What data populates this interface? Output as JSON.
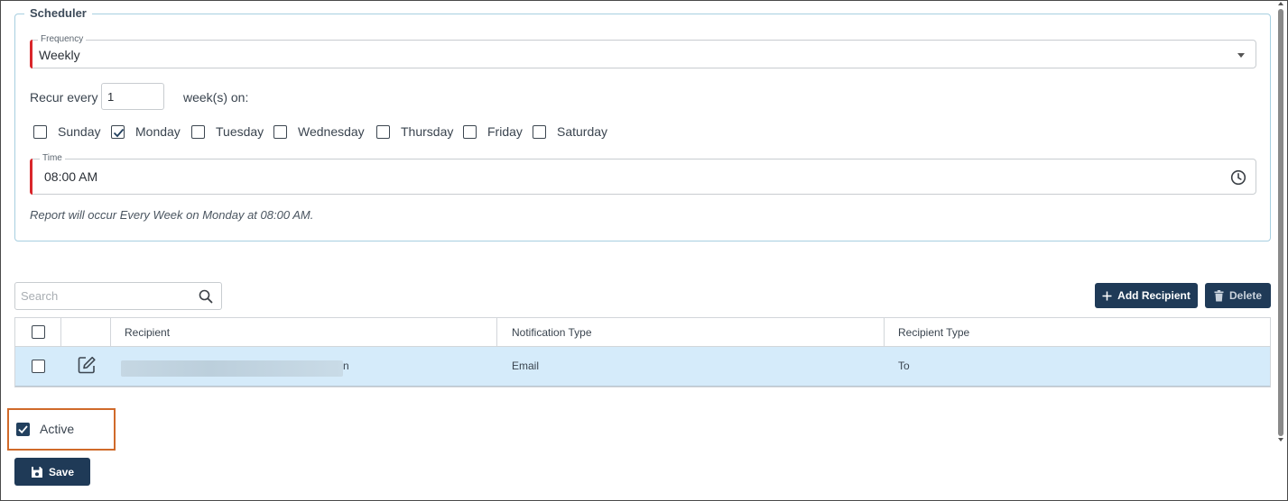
{
  "scheduler": {
    "title": "Scheduler",
    "frequency": {
      "label": "Frequency",
      "value": "Weekly"
    },
    "recur": {
      "prefix": "Recur every",
      "value": "1",
      "suffix": "week(s) on:"
    },
    "days": [
      {
        "label": "Sunday",
        "checked": false
      },
      {
        "label": "Monday",
        "checked": true
      },
      {
        "label": "Tuesday",
        "checked": false
      },
      {
        "label": "Wednesday",
        "checked": false
      },
      {
        "label": "Thursday",
        "checked": false
      },
      {
        "label": "Friday",
        "checked": false
      },
      {
        "label": "Saturday",
        "checked": false
      }
    ],
    "time": {
      "label": "Time",
      "value": "08:00 AM"
    },
    "summary": "Report will occur Every Week on Monday at 08:00 AM."
  },
  "search": {
    "placeholder": "Search"
  },
  "buttons": {
    "add_recipient": "Add Recipient",
    "delete": "Delete",
    "save": "Save"
  },
  "table": {
    "headers": [
      "Recipient",
      "Notification Type",
      "Recipient Type"
    ],
    "rows": [
      {
        "recipient_visible_tail": "n",
        "notification_type": "Email",
        "recipient_type": "To",
        "checked": false
      }
    ]
  },
  "active": {
    "label": "Active",
    "checked": true
  },
  "colors": {
    "primary": "#1f3a57",
    "required": "#d9262b",
    "row_selected": "#d5ebfa",
    "highlight": "#d06a2a",
    "fieldset_border": "#a7cfe0"
  },
  "icons": {
    "frequency_dropdown": "caret-down-icon",
    "time": "clock-icon",
    "search": "search-icon",
    "add": "plus-icon",
    "delete": "trash-icon",
    "edit": "edit-icon",
    "save": "floppy-disk-icon"
  }
}
